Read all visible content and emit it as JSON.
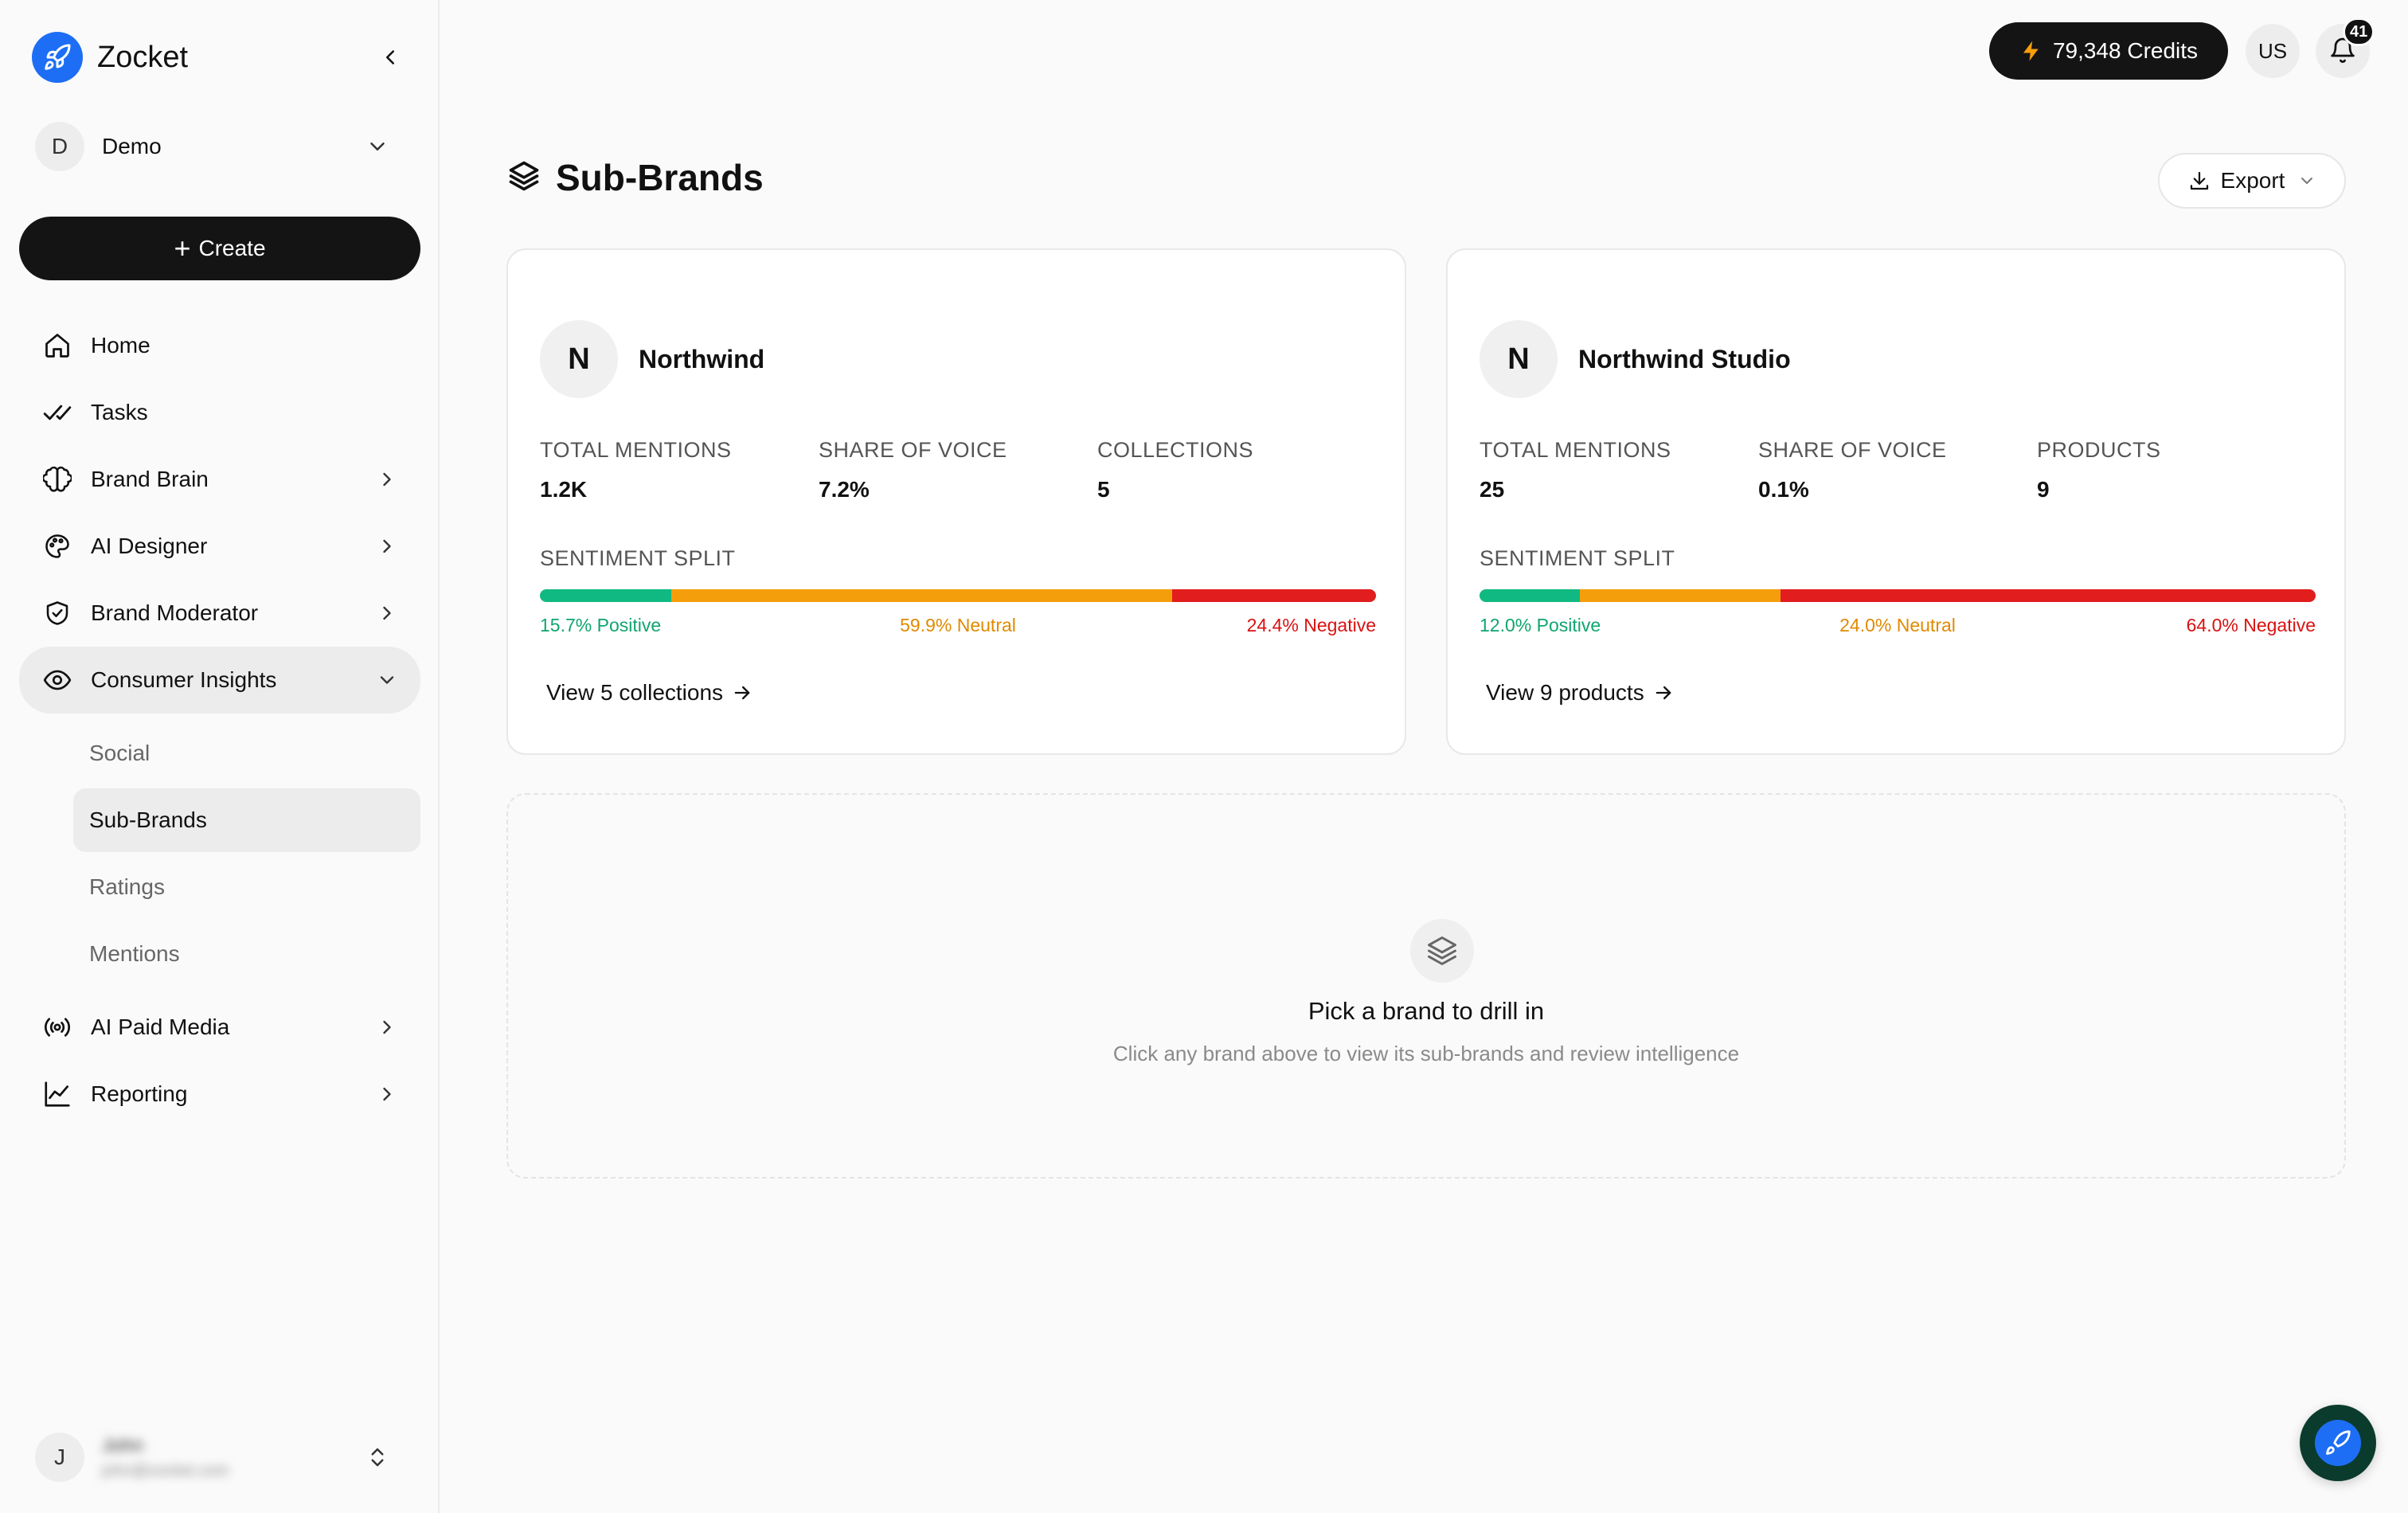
{
  "app": {
    "name": "Zocket"
  },
  "workspace": {
    "initial": "D",
    "name": "Demo"
  },
  "sidebar": {
    "create_label": "Create",
    "items": [
      {
        "label": "Home"
      },
      {
        "label": "Tasks"
      },
      {
        "label": "Brand Brain"
      },
      {
        "label": "AI Designer"
      },
      {
        "label": "Brand Moderator"
      },
      {
        "label": "Consumer Insights"
      },
      {
        "label": "AI Paid Media"
      },
      {
        "label": "Reporting"
      }
    ],
    "consumer_insights_sub": [
      {
        "label": "Social"
      },
      {
        "label": "Sub-Brands"
      },
      {
        "label": "Ratings"
      },
      {
        "label": "Mentions"
      }
    ]
  },
  "user": {
    "initial": "J",
    "name": "John",
    "email": "john@zocket.com"
  },
  "topbar": {
    "credits_label": "79,348 Credits",
    "locale": "US",
    "notification_count": "41"
  },
  "page": {
    "title": "Sub-Brands",
    "export_label": "Export"
  },
  "brands": [
    {
      "initial": "N",
      "name": "Northwind",
      "metrics": [
        {
          "label": "TOTAL MENTIONS",
          "value": "1.2K"
        },
        {
          "label": "SHARE OF VOICE",
          "value": "7.2%"
        },
        {
          "label": "COLLECTIONS",
          "value": "5"
        }
      ],
      "sentiment_label": "SENTIMENT SPLIT",
      "sentiment": {
        "positive": 15.7,
        "neutral": 59.9,
        "negative": 24.4
      },
      "sentiment_text": {
        "positive": "15.7% Positive",
        "neutral": "59.9% Neutral",
        "negative": "24.4% Negative"
      },
      "link_label": "View 5 collections"
    },
    {
      "initial": "N",
      "name": "Northwind Studio",
      "metrics": [
        {
          "label": "TOTAL MENTIONS",
          "value": "25"
        },
        {
          "label": "SHARE OF VOICE",
          "value": "0.1%"
        },
        {
          "label": "PRODUCTS",
          "value": "9"
        }
      ],
      "sentiment_label": "SENTIMENT SPLIT",
      "sentiment": {
        "positive": 12.0,
        "neutral": 24.0,
        "negative": 64.0
      },
      "sentiment_text": {
        "positive": "12.0% Positive",
        "neutral": "24.0% Neutral",
        "negative": "64.0% Negative"
      },
      "link_label": "View 9 products"
    }
  ],
  "empty_state": {
    "title": "Pick a brand to drill in",
    "subtitle": "Click any brand above to view its sub-brands and review intelligence"
  },
  "colors": {
    "positive": "#10b981",
    "neutral": "#f59e0b",
    "negative": "#e11d1d",
    "accent": "#1d6ef5"
  }
}
